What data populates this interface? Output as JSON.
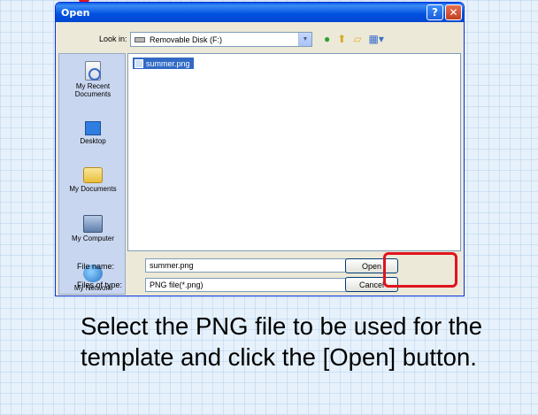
{
  "dialog": {
    "title": "Open",
    "look_in_label": "Look in:",
    "look_in_value": "Removable Disk (F:)",
    "files": [
      "summer.png"
    ],
    "places": [
      "My Recent Documents",
      "Desktop",
      "My Documents",
      "My Computer",
      "My Network"
    ],
    "file_name_label": "File name:",
    "file_name_value": "summer.png",
    "file_type_label": "Files of type:",
    "file_type_value": "PNG file(*.png)",
    "open_label": "Open",
    "cancel_label": "Cancel"
  },
  "caption": "Select the PNG file to be used for the template and click the [Open] button.",
  "colors": {
    "highlight": "#e0141e",
    "titlebar": "#0050e0",
    "selection": "#316ac5"
  }
}
